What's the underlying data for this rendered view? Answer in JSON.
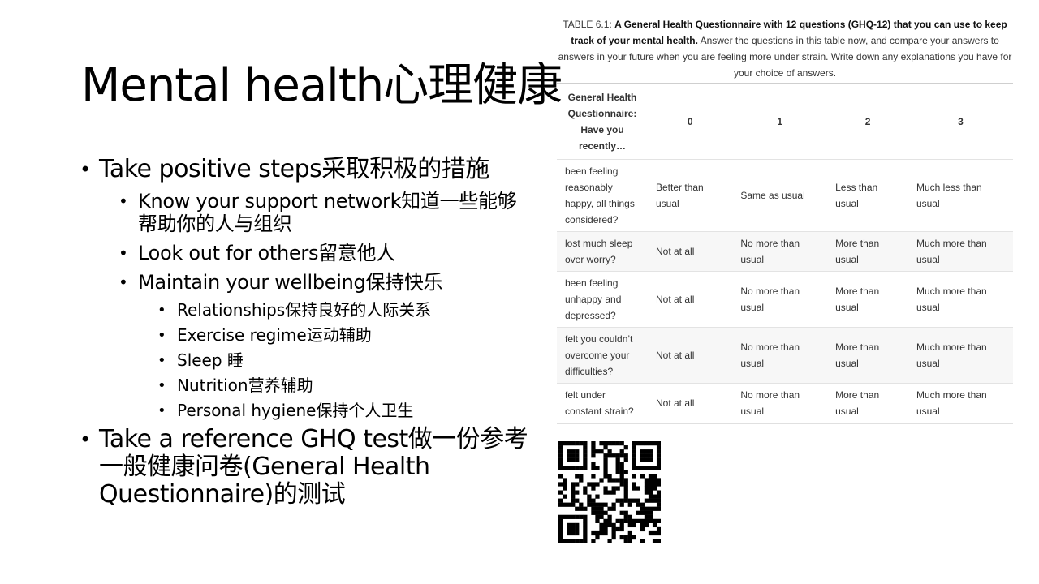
{
  "title": "Mental health心理健康",
  "bullets": {
    "l1a": "Take positive steps采取积极的措施",
    "l2a": "Know your support network知道一些能够帮助你的人与组织",
    "l2b": "Look out for others留意他人",
    "l2c": "Maintain your wellbeing保持快乐",
    "l3": [
      "Relationships保持良好的人际关系",
      "Exercise regime运动辅助",
      "Sleep 睡",
      "Nutrition营养辅助",
      "Personal hygiene保持个人卫生"
    ],
    "l1b": "Take a reference GHQ test做一份参考一般健康问卷(General Health Questionnaire)的测试"
  },
  "table": {
    "caption_prefix": "TABLE 6.1: ",
    "caption_bold": "A General Health Questionnaire with 12 questions (GHQ-12) that you can use to keep track of your mental health.",
    "caption_rest": " Answer the questions in this table now, and compare your answers to answers in your future when you are feeling more under strain. Write down any explanations you have for your choice of answers.",
    "headers": [
      "General Health Questionnaire: Have you recently…",
      "0",
      "1",
      "2",
      "3"
    ],
    "rows": [
      [
        "been feeling reasonably happy, all things considered?",
        "Better than usual",
        "Same as usual",
        "Less than usual",
        "Much less than usual"
      ],
      [
        "lost much sleep over worry?",
        "Not at all",
        "No more than usual",
        "More than usual",
        "Much more than usual"
      ],
      [
        "been feeling unhappy and depressed?",
        "Not at all",
        "No more than usual",
        "More than usual",
        "Much more than usual"
      ],
      [
        "felt you couldn’t overcome your difficulties?",
        "Not at all",
        "No more than usual",
        "More than usual",
        "Much more than usual"
      ],
      [
        "felt under constant strain?",
        "Not at all",
        "No more than usual",
        "More than usual",
        "Much more than usual"
      ]
    ]
  },
  "qr_code": "qr-code-icon"
}
